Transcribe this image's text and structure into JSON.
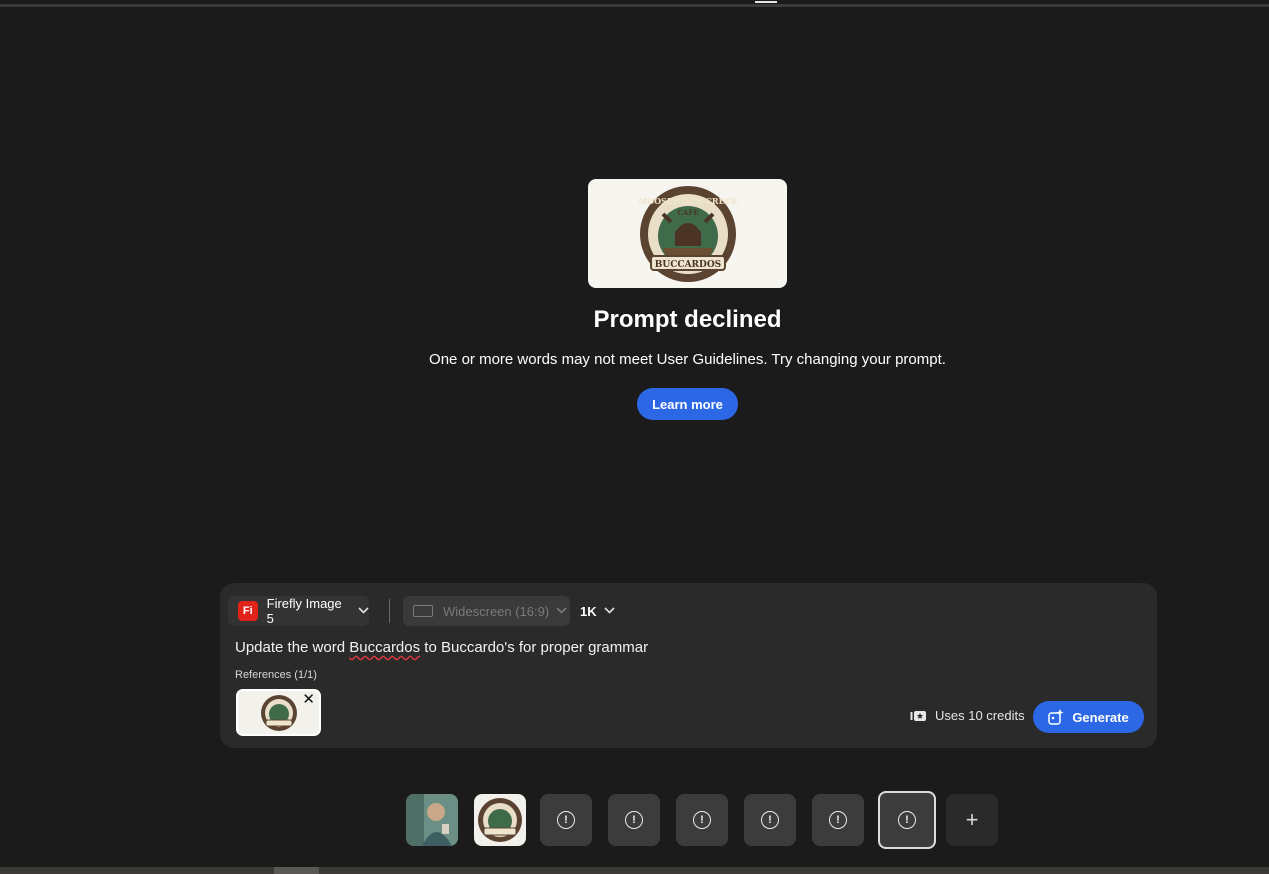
{
  "status": {
    "title": "Prompt declined",
    "message": "One or more words may not meet User Guidelines. Try changing your prompt.",
    "learn_more_label": "Learn more"
  },
  "toolbar": {
    "model_badge": "Fi",
    "model_label": "Firefly Image 5",
    "aspect_label": "Widescreen (16:9)",
    "resolution_label": "1K"
  },
  "prompt": {
    "text_before": "Update the word ",
    "text_flagged": "Buccardos",
    "text_after": " to Buccardo's for proper grammar"
  },
  "references": {
    "label": "References (1/1)",
    "remove_symbol": "✕"
  },
  "credits": {
    "label": "Uses 10 credits"
  },
  "generate_label": "Generate",
  "history": {
    "add_symbol": "+",
    "warning_symbol": "!"
  },
  "colors": {
    "background": "#1b1b1b",
    "panel": "#2a2a2a",
    "accent": "#2c68e6",
    "firefly_red": "#e2231a"
  }
}
